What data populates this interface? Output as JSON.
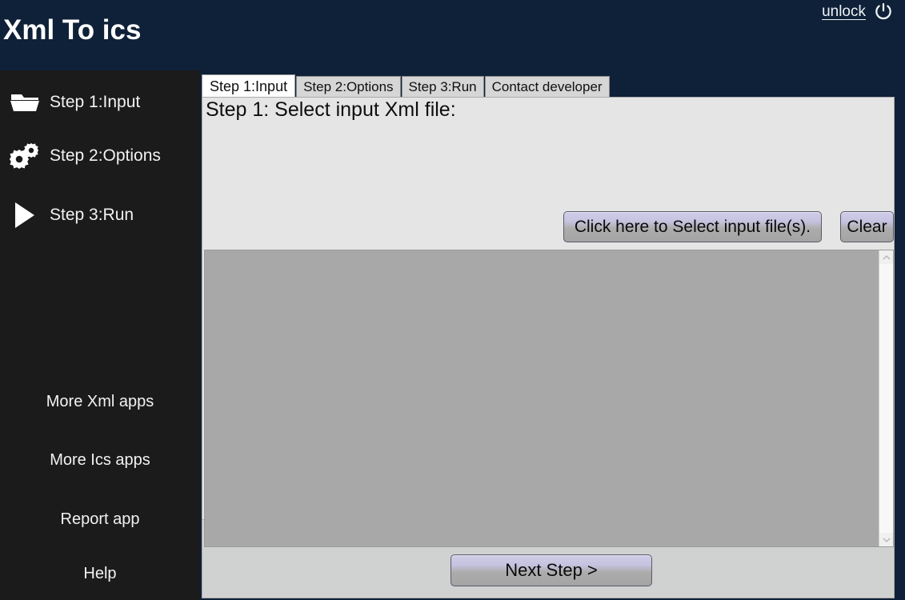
{
  "header": {
    "title": "Xml To ics",
    "unlock_label": "unlock",
    "power_icon": "power-icon",
    "background_color": "#0f2138"
  },
  "sidebar": {
    "background_color": "#1b1b1b",
    "steps": [
      {
        "label": "Step 1:Input",
        "icon": "folder-icon"
      },
      {
        "label": "Step 2:Options",
        "icon": "gears-icon"
      },
      {
        "label": "Step 3:Run",
        "icon": "play-icon"
      }
    ],
    "links": [
      {
        "label": "More Xml apps"
      },
      {
        "label": "More Ics apps"
      },
      {
        "label": "Report app"
      },
      {
        "label": "Help"
      }
    ]
  },
  "main": {
    "tabs": [
      {
        "label": "Step 1:Input",
        "active": true
      },
      {
        "label": "Step 2:Options",
        "active": false
      },
      {
        "label": "Step 3:Run",
        "active": false
      },
      {
        "label": "Contact developer",
        "active": false
      }
    ],
    "page": {
      "title": "Step 1: Select input Xml file:",
      "select_files_label": "Click here to Select input file(s).",
      "clear_label": "Clear",
      "next_step_label": "Next Step >",
      "file_list_items": [],
      "file_list_background": "#a8a8a8",
      "panel_background": "#e5e5e5"
    },
    "scrollbar": {
      "up_arrow_icon": "chevron-up-icon",
      "down_arrow_icon": "chevron-down-icon"
    }
  }
}
